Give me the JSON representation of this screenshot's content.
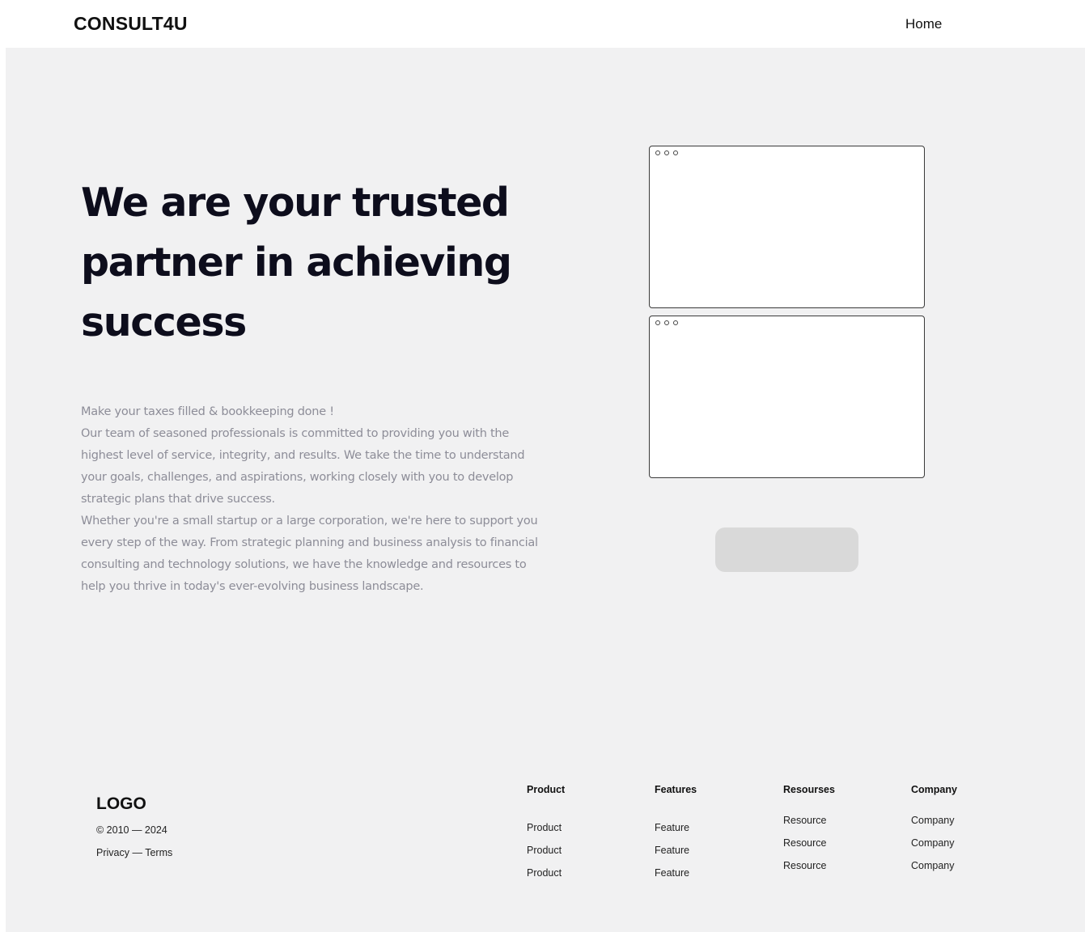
{
  "navbar": {
    "brand": "CONSULT4U",
    "home_label": "Home"
  },
  "hero": {
    "title": "We are your trusted partner in achieving success",
    "paragraphs": [
      "Make your taxes filled & bookkeeping done !",
      "Our team of seasoned professionals is committed to providing you with the highest level of service, integrity, and results. We take the time to understand your goals, challenges, and aspirations, working closely with you to develop strategic plans that drive success.",
      "Whether you're a small startup or a large corporation, we're here to support you every step of the way. From strategic planning and business analysis to financial consulting and technology solutions, we have the knowledge and resources to help you thrive in today's ever-evolving business landscape."
    ]
  },
  "footer": {
    "logo": "LOGO",
    "copyright": "© 2010 — 2024",
    "privacy": "Privacy",
    "separator": " — ",
    "terms": "Terms",
    "columns": [
      {
        "title": "Product",
        "links": [
          "Product",
          "Product",
          "Product"
        ]
      },
      {
        "title": "Features",
        "links": [
          "Feature",
          "Feature",
          "Feature"
        ]
      },
      {
        "title": "Resourses",
        "links": [
          "Resource",
          "Resource",
          "Resource"
        ]
      },
      {
        "title": "Company",
        "links": [
          "Company",
          "Company",
          "Company"
        ]
      }
    ]
  },
  "colors": {
    "page_background": "#f1f1f2",
    "navbar_background": "#ffffff",
    "title_text": "#0d0d1c",
    "body_text": "#8d8d98",
    "button_fill": "#d9d9d9"
  }
}
